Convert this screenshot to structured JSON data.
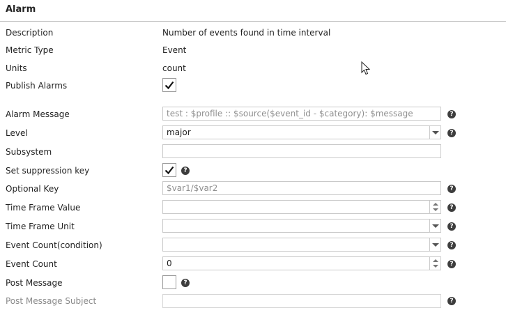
{
  "section_title": "Alarm",
  "description": {
    "label": "Description",
    "value": "Number of events found in time interval"
  },
  "metric_type": {
    "label": "Metric Type",
    "value": "Event"
  },
  "units": {
    "label": "Units",
    "value": "count"
  },
  "publish_alarms": {
    "label": "Publish Alarms",
    "checked": true
  },
  "alarm_message": {
    "label": "Alarm Message",
    "placeholder": "test :  $profile :: $source($event_id - $category): $message",
    "help_icon": "help-icon"
  },
  "level": {
    "label": "Level",
    "value": "major",
    "help_icon": "help-icon"
  },
  "subsystem": {
    "label": "Subsystem",
    "value": ""
  },
  "suppression_key": {
    "label": "Set suppression key",
    "checked": true,
    "help_icon": "help-icon"
  },
  "optional_key": {
    "label": "Optional Key",
    "placeholder": "$var1/$var2",
    "help_icon": "help-icon"
  },
  "time_frame_value": {
    "label": "Time Frame Value",
    "value": "",
    "help_icon": "help-icon"
  },
  "time_frame_unit": {
    "label": "Time Frame Unit",
    "value": "",
    "help_icon": "help-icon"
  },
  "event_count_condition": {
    "label": "Event Count(condition)",
    "value": "",
    "help_icon": "help-icon"
  },
  "event_count": {
    "label": "Event Count",
    "value": "0",
    "help_icon": "help-icon"
  },
  "post_message": {
    "label": "Post Message",
    "checked": false,
    "help_icon": "help-icon"
  },
  "post_message_subject": {
    "label": "Post Message Subject",
    "value": "",
    "disabled": true,
    "help_icon": "help-icon"
  },
  "help_glyph": "?",
  "colors": {
    "help_bg": "#3d3d3d",
    "border": "#c9c9c9",
    "disabled_text": "#8a8a8a"
  }
}
